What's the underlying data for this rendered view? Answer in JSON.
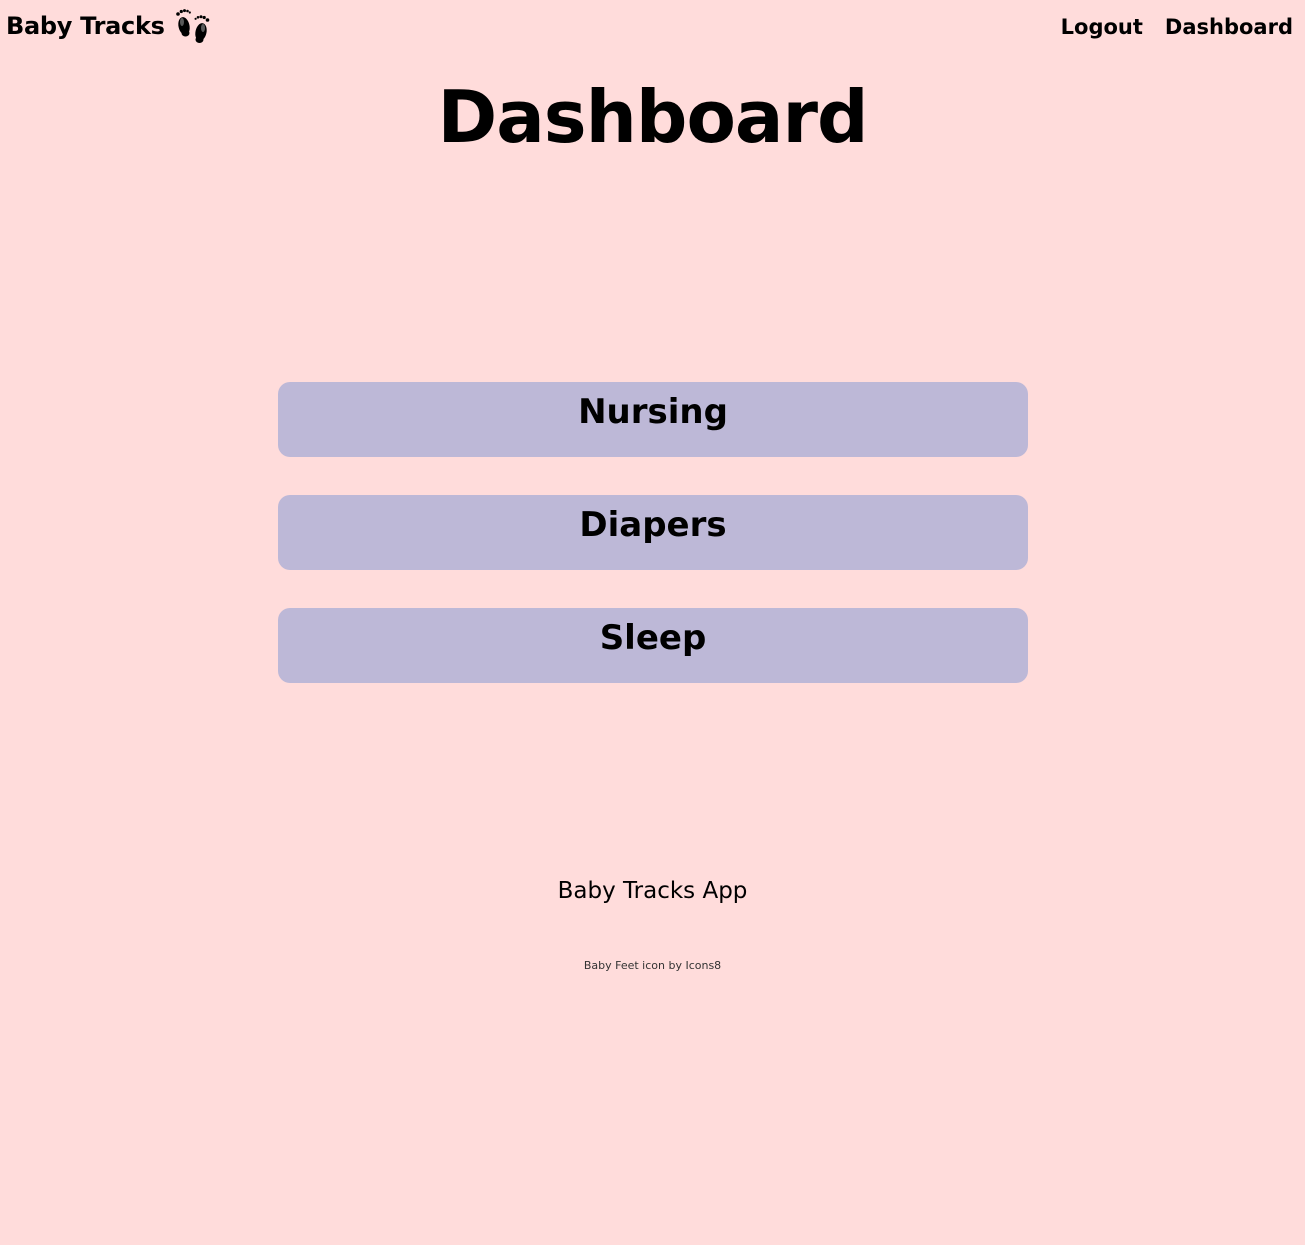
{
  "header": {
    "brand": "Baby Tracks",
    "brand_icon": "baby-feet-icon",
    "nav": {
      "logout": "Logout",
      "dashboard": "Dashboard"
    }
  },
  "main": {
    "title": "Dashboard",
    "tiles": [
      {
        "label": "Nursing"
      },
      {
        "label": "Diapers"
      },
      {
        "label": "Sleep"
      }
    ]
  },
  "footer": {
    "app_name": "Baby Tracks App",
    "credit_prefix": "Baby Feet icon by ",
    "credit_link": "Icons8"
  },
  "colors": {
    "background": "#ffdcdb",
    "tile": "#bdb8d7",
    "text": "#000000"
  }
}
